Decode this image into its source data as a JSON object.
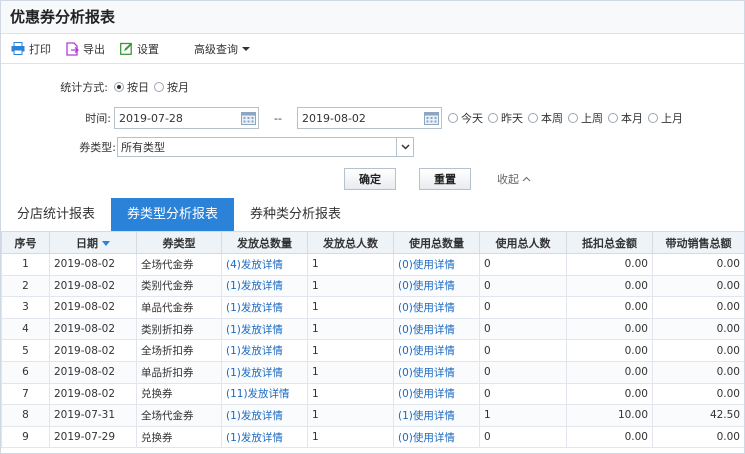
{
  "title": "优惠券分析报表",
  "toolbar": {
    "print": "打印",
    "export": "导出",
    "settings": "设置",
    "advanced": "高级查询"
  },
  "form": {
    "stat_label": "统计方式:",
    "by_day": "按日",
    "by_month": "按月",
    "time_label": "时间:",
    "start_date": "2019-07-28",
    "separator": "--",
    "end_date": "2019-08-02",
    "quick": [
      "今天",
      "昨天",
      "本周",
      "上周",
      "本月",
      "上月"
    ],
    "type_label": "券类型:",
    "type_value": "所有类型",
    "confirm": "确定",
    "reset": "重置",
    "collapse": "收起"
  },
  "tabs": [
    "分店统计报表",
    "券类型分析报表",
    "券种类分析报表"
  ],
  "table": {
    "headers": [
      "序号",
      "日期",
      "券类型",
      "发放总数量",
      "发放总人数",
      "使用总数量",
      "使用总人数",
      "抵扣总金额",
      "带动销售总额"
    ],
    "rows": [
      {
        "no": "1",
        "date": "2019-08-02",
        "type": "全场代金券",
        "issued": "(4)发放详情",
        "issued_people": "1",
        "used": "(0)使用详情",
        "used_people": "0",
        "deduct": "0.00",
        "sales": "0.00"
      },
      {
        "no": "2",
        "date": "2019-08-02",
        "type": "类别代金券",
        "issued": "(1)发放详情",
        "issued_people": "1",
        "used": "(0)使用详情",
        "used_people": "0",
        "deduct": "0.00",
        "sales": "0.00"
      },
      {
        "no": "3",
        "date": "2019-08-02",
        "type": "单品代金券",
        "issued": "(1)发放详情",
        "issued_people": "1",
        "used": "(0)使用详情",
        "used_people": "0",
        "deduct": "0.00",
        "sales": "0.00"
      },
      {
        "no": "4",
        "date": "2019-08-02",
        "type": "类别折扣券",
        "issued": "(1)发放详情",
        "issued_people": "1",
        "used": "(0)使用详情",
        "used_people": "0",
        "deduct": "0.00",
        "sales": "0.00"
      },
      {
        "no": "5",
        "date": "2019-08-02",
        "type": "全场折扣券",
        "issued": "(1)发放详情",
        "issued_people": "1",
        "used": "(0)使用详情",
        "used_people": "0",
        "deduct": "0.00",
        "sales": "0.00"
      },
      {
        "no": "6",
        "date": "2019-08-02",
        "type": "单品折扣券",
        "issued": "(1)发放详情",
        "issued_people": "1",
        "used": "(0)使用详情",
        "used_people": "0",
        "deduct": "0.00",
        "sales": "0.00"
      },
      {
        "no": "7",
        "date": "2019-08-02",
        "type": "兑换券",
        "issued": "(11)发放详情",
        "issued_people": "1",
        "used": "(0)使用详情",
        "used_people": "0",
        "deduct": "0.00",
        "sales": "0.00"
      },
      {
        "no": "8",
        "date": "2019-07-31",
        "type": "全场代金券",
        "issued": "(1)发放详情",
        "issued_people": "1",
        "used": "(1)使用详情",
        "used_people": "1",
        "deduct": "10.00",
        "sales": "42.50"
      },
      {
        "no": "9",
        "date": "2019-07-29",
        "type": "兑换券",
        "issued": "(1)发放详情",
        "issued_people": "1",
        "used": "(0)使用详情",
        "used_people": "0",
        "deduct": "0.00",
        "sales": "0.00"
      }
    ]
  },
  "colors": {
    "accent": "#2b82d9",
    "link": "#1c6ac2"
  }
}
